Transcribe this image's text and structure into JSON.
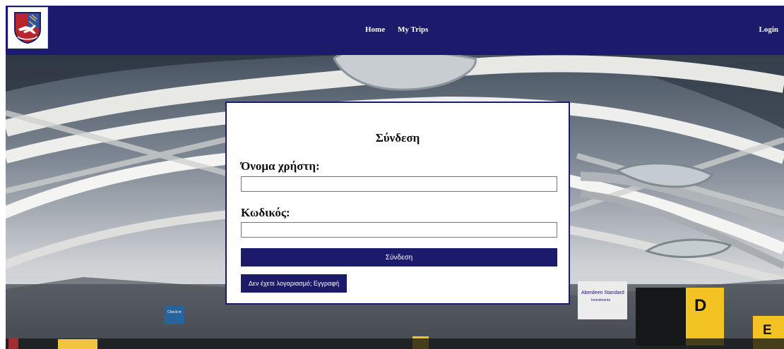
{
  "navbar": {
    "logo_icon": "airline-crest-icon",
    "links": [
      "Home",
      "My Trips"
    ],
    "login": "Login",
    "background_color": "#1c1a6b"
  },
  "login_form": {
    "title": "Σύνδεση",
    "username_label": "Όνομα χρήστη:",
    "username_value": "",
    "password_label": "Κωδικός:",
    "password_value": "",
    "submit_label": "Σύνδεση",
    "register_label": "Δεν έχετε λογαριασμό; Εγγραφή",
    "accent_color": "#1c1a6b"
  },
  "background": {
    "signs": [
      "Check-in",
      "Aberdeen Standard",
      "Investments",
      "D",
      "E"
    ]
  }
}
